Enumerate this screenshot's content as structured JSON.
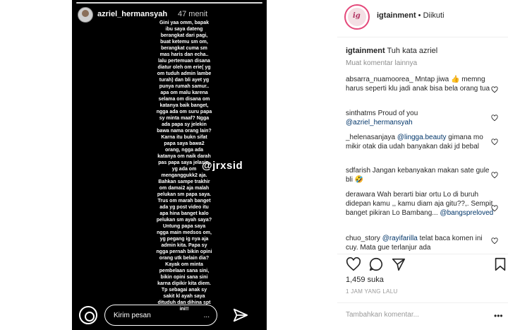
{
  "story": {
    "username": "azriel_hermansyah",
    "time": "47 menit",
    "text": "Gini yaa omm, bapak\nibu saya dateng\nberangkat dari pagi,\nbuat ketemu sm om,\nberangkat cuma sm\nmas haris dan echa..\nlalu pertemuan disana\ndiatur oleh om erie( yg\nom tuduh admin lambe\nturah) dan bli ayet yg\npunya rumah samur..\napa om malu karena\nselama om disana om\nkatanya baik banget,\nngga ada om suru papa\nsy minta maaf? Ngga\nada papa sy jelekin\nbawa nama orang lain?\nKarna itu bukn sifat\npapa saya bawa2\norang, ngga ada\nkatanya om naik darah\npas papa saya jelasin,\nyg ada om\nmenganggukk2 aja.\nBahkan sampe trakhir\nom damai2 aja malah\npelukan sm papa saya.\nTrus om marah banget\nada yg post video itu\napa hina banget kalo\npelukan sm ayah saya?\nUntung papa saya\nngga main medsos om,\nyg pegang ig nya aja\nadmin kita. Papa sy\nngga pernah bikin opini\norang utk belain dia?\nKayak om minta\npembelaan sana sini,\nbikin opini sana sini\nkarna dipikir kita diem.\nTp sebagai anak sy\nsakit kl ayah saya\ndituduh dan dihina spt\nini!!",
    "watermark": "@jrxsid",
    "reply_placeholder": "Kirim pesan",
    "reply_dots": "..."
  },
  "post": {
    "account": "igtainment",
    "follow_sep": " • ",
    "follow_label": "Diikuti",
    "caption_user": "igtainment",
    "caption_text": "Tuh kata azriel",
    "more_comments": "Muat komentar lainnya",
    "comments": [
      {
        "user": "absarra_nuamoorea_",
        "text": "Mntap jiwa 👍 memng harus seperti klu jadi anak bisa bela orang tua"
      },
      {
        "user": "sinthatms",
        "text": "Proud of you",
        "mention": "@azriel_hermansyah"
      },
      {
        "user": "_helenasanjaya",
        "mention": "@lingga.beauty",
        "text": "gimana mo mikir otak dia udah banyakan daki jd bebal"
      },
      {
        "user": "sdfarish",
        "text": "Jangan kebanyakan makan sate gule bli 🤣"
      },
      {
        "user": "derawara",
        "text": "Wah berarti biar ortu Lo di buruh didepan kamu ,, kamu diam aja gitu??,. Sempit banget pikiran Lo Bambang...",
        "mention": "@bangspreloved"
      },
      {
        "user": "chuo_story",
        "mention": "@rayifarilla",
        "text": "telat baca komen ini cuy. Mata gue terlanjur ada"
      }
    ],
    "likes": "1,459 suka",
    "timestamp": "1 JAM YANG LALU",
    "add_comment_placeholder": "Tambahkan komentar...",
    "more_dots": "•••"
  }
}
